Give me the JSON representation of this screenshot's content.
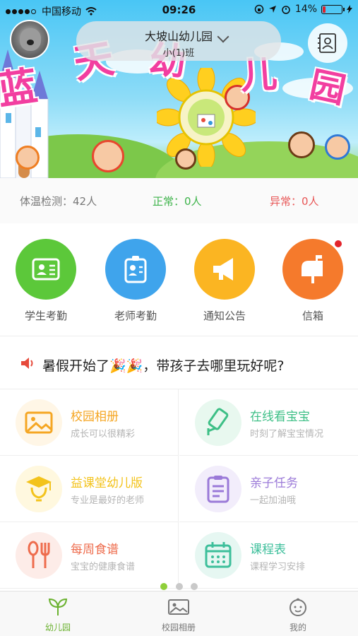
{
  "status_bar": {
    "carrier": "中国移动",
    "time": "09:26",
    "battery": "14%",
    "battery_level": 0.14,
    "signal_icon": "signal-dots-icon",
    "wifi_icon": "wifi-icon"
  },
  "banner": {
    "chars": [
      "蓝",
      "天",
      "幼",
      "儿",
      "园"
    ],
    "colors": {
      "sky": "#49c6f5",
      "grass": "#8fd56a",
      "title_pink": "#f23ea0"
    }
  },
  "header": {
    "school_name": "大坡山幼儿园",
    "class_name": "小(1)班",
    "avatar_icon": "koala-avatar",
    "contacts_icon": "contacts-book-icon",
    "chevron_icon": "chevron-down-icon"
  },
  "temperature": {
    "checked": "体温检测：42人",
    "normal": "正常：0人",
    "abnormal": "异常：0人",
    "colors": {
      "normal": "#3db34a",
      "abnormal": "#e85757"
    }
  },
  "quick_actions": [
    {
      "label": "学生考勤",
      "icon": "student-id-card-icon",
      "color": "#5cc83a"
    },
    {
      "label": "老师考勤",
      "icon": "teacher-badge-icon",
      "color": "#3fa4ec"
    },
    {
      "label": "通知公告",
      "icon": "megaphone-icon",
      "color": "#fbb522"
    },
    {
      "label": "信箱",
      "icon": "mailbox-icon",
      "color": "#f57a2c",
      "has_badge": true
    }
  ],
  "notice": {
    "text": "暑假开始了🎉🎉，带孩子去哪里玩好呢?",
    "icon": "speaker-icon"
  },
  "features": [
    {
      "title": "校园相册",
      "subtitle": "成长可以很精彩",
      "icon": "photo-album-icon",
      "color": "#f5a623",
      "bg": "#fff6e6"
    },
    {
      "title": "在线看宝宝",
      "subtitle": "时刻了解宝宝情况",
      "icon": "camera-icon",
      "color": "#3dbf86",
      "bg": "#e8f8ef"
    },
    {
      "title": "益课堂幼儿版",
      "subtitle": "专业是最好的老师",
      "icon": "graduation-bulb-icon",
      "color": "#f3c31c",
      "bg": "#fff8df"
    },
    {
      "title": "亲子任务",
      "subtitle": "一起加油哦",
      "icon": "clipboard-icon",
      "color": "#9b7ad8",
      "bg": "#f2edfb"
    },
    {
      "title": "每周食谱",
      "subtitle": "宝宝的健康食谱",
      "icon": "spoon-fork-icon",
      "color": "#ee6c4d",
      "bg": "#fdece8"
    },
    {
      "title": "课程表",
      "subtitle": "课程学习安排",
      "icon": "calendar-icon",
      "color": "#3dbf9b",
      "bg": "#e6f7f2"
    }
  ],
  "pager": {
    "pages": 3,
    "active": 1
  },
  "tabbar": [
    {
      "label": "幼儿园",
      "icon": "leaf-sprout-icon",
      "active": true
    },
    {
      "label": "校园相册",
      "icon": "album-icon",
      "active": false
    },
    {
      "label": "我的",
      "icon": "baby-face-icon",
      "active": false
    }
  ]
}
